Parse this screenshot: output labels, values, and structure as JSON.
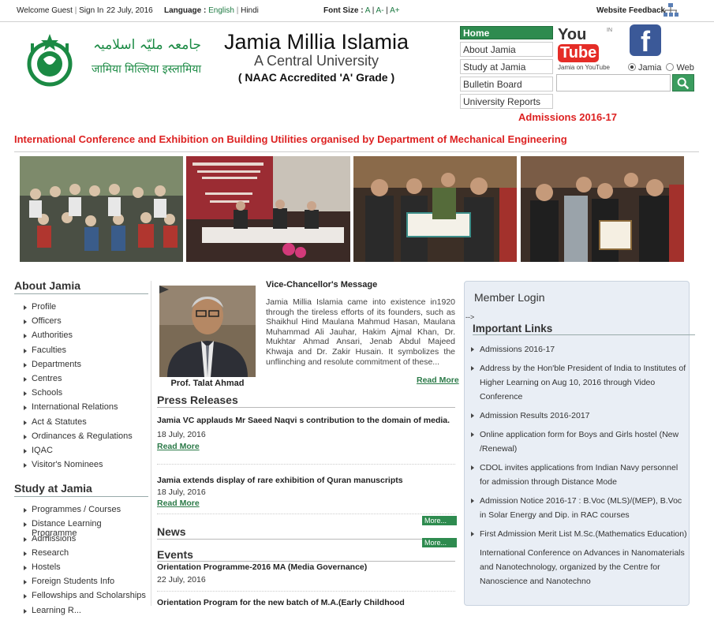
{
  "topbar": {
    "welcome": "Welcome Guest",
    "sign_in": "Sign In",
    "date": "22 July, 2016",
    "language_label": "Language :",
    "lang_english": "English",
    "lang_hindi": "Hindi",
    "font_size_label": "Font Size :",
    "font_a": "A",
    "font_a_minus": "A-",
    "font_a_plus": "A+",
    "feedback": "Website Feedback"
  },
  "header": {
    "urdu_name": "جامعہ ملیّہ اسلامیہ",
    "hindi_name": "जामिया मिल्लिया इस्लामिया",
    "title": "Jamia Millia Islamia",
    "subtitle": "A Central University",
    "accreditation": "( NAAC Accredited 'A' Grade )"
  },
  "quicklinks": [
    "Home",
    "About Jamia",
    "Study at Jamia",
    "Bulletin Board",
    "University Reports"
  ],
  "social": {
    "youtube_you": "You",
    "youtube_tube": "Tube",
    "youtube_in": "IN",
    "youtube_caption": "Jamia on YouTube",
    "facebook": "f"
  },
  "search": {
    "option_jamia": "Jamia",
    "option_web": "Web",
    "placeholder": ""
  },
  "admissions_link": "Admissions 2016-17",
  "marquee": "International Conference and Exhibition on Building Utilities organised by Department of Mechanical Engineering",
  "sidebar": {
    "about_heading": "About Jamia",
    "about_items": [
      "Profile",
      "Officers",
      "Authorities",
      "Faculties",
      "Departments",
      "Centres",
      "Schools",
      "International Relations",
      "Act & Statutes",
      "Ordinances & Regulations",
      "IQAC",
      "Visitor's Nominees"
    ],
    "study_heading": "Study at Jamia",
    "study_items": [
      "Programmes / Courses",
      "Distance Learning Programme",
      "Admissions",
      "Research",
      "Hostels",
      "Foreign Students Info",
      "Fellowships and Scholarships",
      "Learning R..."
    ]
  },
  "vc": {
    "heading": "Vice-Chancellor's Message",
    "text": "Jamia Millia Islamia came into existence in1920 through the tireless efforts of its founders, such as Shaikhul Hind Maulana Mahmud Hasan, Maulana Muhammad Ali Jauhar, Hakim Ajmal Khan, Dr. Mukhtar Ahmad Ansari, Jenab Abdul Majeed Khwaja and Dr. Zakir Husain. It symbolizes the unflinching and resolute commitment of these...",
    "name": "Prof. Talat Ahmad",
    "read_more": "Read More"
  },
  "press": {
    "heading": "Press Releases",
    "items": [
      {
        "title": "Jamia VC applauds Mr Saeed Naqvi s contribution to the domain of media.",
        "date": "18 July, 2016",
        "read_more": "Read More"
      },
      {
        "title": "Jamia extends display of rare exhibition of Quran manuscripts",
        "date": "18 July, 2016",
        "read_more": "Read More"
      }
    ],
    "more": "More..."
  },
  "news": {
    "heading": "News",
    "more": "More..."
  },
  "events": {
    "heading": "Events",
    "items": [
      {
        "title": "Orientation Programme-2016 MA (Media Governance)",
        "date": "22 July, 2016"
      },
      {
        "title": "Orientation Program for the new batch of M.A.(Early Childhood",
        "date": ""
      }
    ]
  },
  "right": {
    "member_login": "Member Login",
    "arrow_text": "-->",
    "important_heading": "Important Links",
    "links": [
      "Admissions 2016-17",
      "Address by the Hon'ble President of India to Institutes of Higher Learning on Aug 10, 2016 through Video Conference",
      "Admission Results 2016-2017",
      "Online application form for Boys and Girls hostel (New /Renewal)",
      "CDOL invites applications from Indian Navy personnel for admission through Distance Mode",
      "Admission Notice 2016-17 : B.Voc (MLS)/(MEP), B.Voc in Solar Energy and Dip. in RAC courses",
      "First Admission Merit List M.Sc.(Mathematics Education)",
      "International Conference on Advances in Nanomaterials and Nanotechnology, organized by the Centre for Nanoscience and Nanotechno"
    ]
  },
  "colors": {
    "brand_green": "#2e8b4f",
    "alert_red": "#dd2222"
  }
}
